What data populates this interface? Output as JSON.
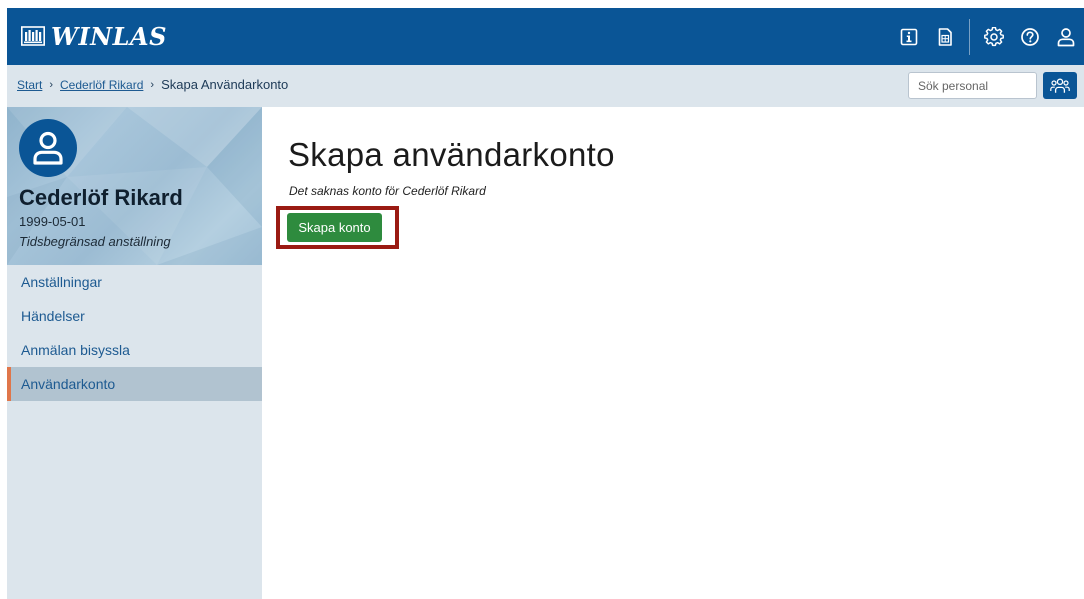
{
  "app": {
    "logo_text": "WINLAS",
    "colors": {
      "primary": "#0a5596",
      "sidebar_bg": "#dce5ec",
      "active_item": "#b1c3d0",
      "accent": "#e0764a",
      "button": "#2e8b3e",
      "highlight": "#9a1a12"
    }
  },
  "topbar": {
    "icons": [
      "info-icon",
      "document-icon",
      "settings-gear-icon",
      "help-icon",
      "user-icon"
    ]
  },
  "breadcrumb": {
    "items": [
      "Start",
      "Cederlöf Rikard"
    ],
    "current": "Skapa Användarkonto",
    "separator": "›"
  },
  "search": {
    "placeholder": "Sök personal",
    "value": ""
  },
  "profile": {
    "name": "Cederlöf Rikard",
    "birthdate": "1999-05-01",
    "employment_type": "Tidsbegränsad anställning"
  },
  "nav": {
    "items": [
      {
        "label": "Anställningar",
        "active": false
      },
      {
        "label": "Händelser",
        "active": false
      },
      {
        "label": "Anmälan bisyssla",
        "active": false
      },
      {
        "label": "Användarkonto",
        "active": true
      }
    ]
  },
  "main": {
    "title": "Skapa användarkonto",
    "subtitle": "Det saknas konto för Cederlöf Rikard",
    "create_button_label": "Skapa konto"
  }
}
